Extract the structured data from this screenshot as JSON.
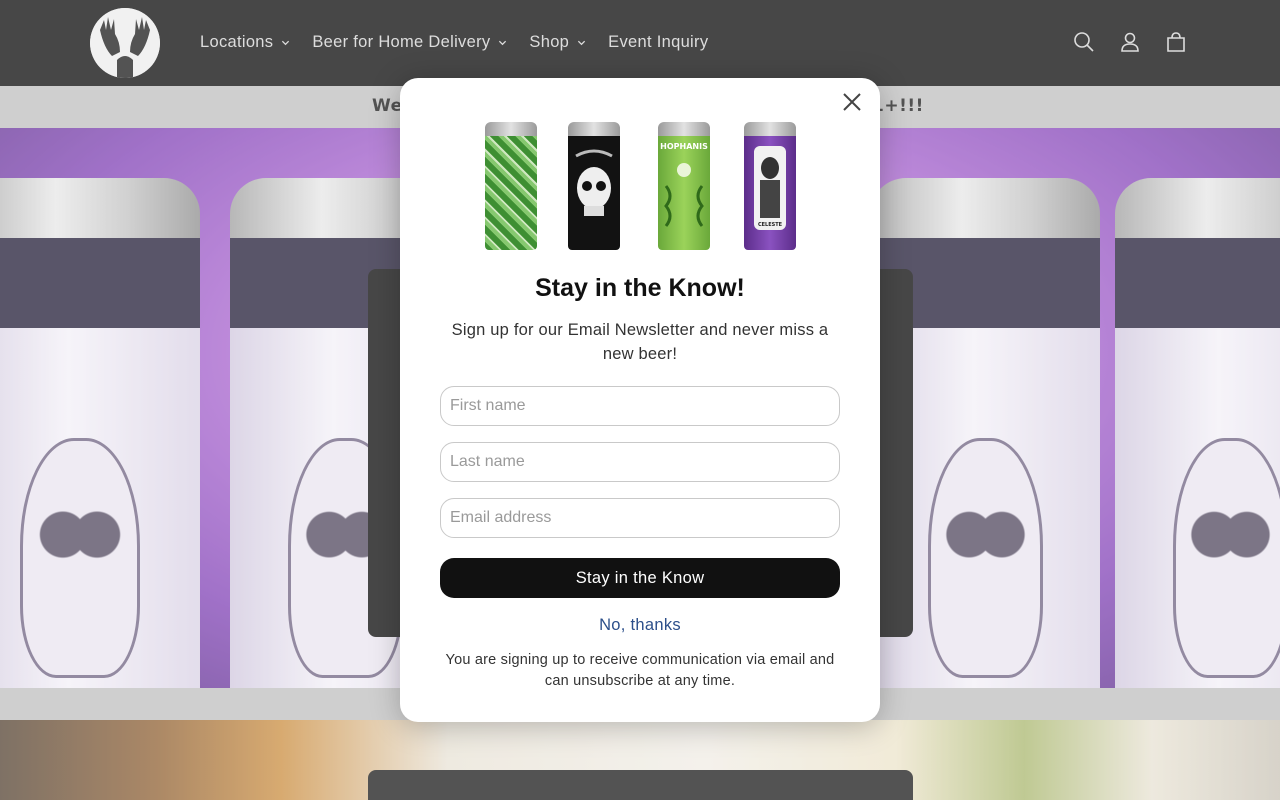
{
  "header": {
    "nav": [
      {
        "label": "Locations",
        "has_dropdown": true
      },
      {
        "label": "Beer for Home Delivery",
        "has_dropdown": true
      },
      {
        "label": "Shop",
        "has_dropdown": true
      },
      {
        "label": "Event Inquiry",
        "has_dropdown": false
      }
    ],
    "icons": [
      "search-icon",
      "account-icon",
      "cart-icon"
    ]
  },
  "announcement": {
    "visible_left": "We",
    "visible_right": "1+!!!"
  },
  "modal": {
    "title": "Stay in the Know!",
    "subtitle": "Sign up for our Email Newsletter and never miss a new beer!",
    "fields": {
      "first_name_placeholder": "First name",
      "last_name_placeholder": "Last name",
      "email_placeholder": "Email address"
    },
    "submit_label": "Stay in the Know",
    "decline_label": "No, thanks",
    "disclaimer": "You are signing up to receive communication via email and can unsubscribe at any time.",
    "cans": [
      "green-snake-can",
      "black-skull-can",
      "green-hophanis-can",
      "purple-figure-can"
    ],
    "can_text": [
      "HOPHANIS",
      "CELESTE"
    ]
  },
  "colors": {
    "header_bg": "#000000",
    "nav_text": "#d0d0d0",
    "announce_bg": "#bdbdbd",
    "submit_bg": "#111111",
    "link": "#2c4f8a"
  }
}
